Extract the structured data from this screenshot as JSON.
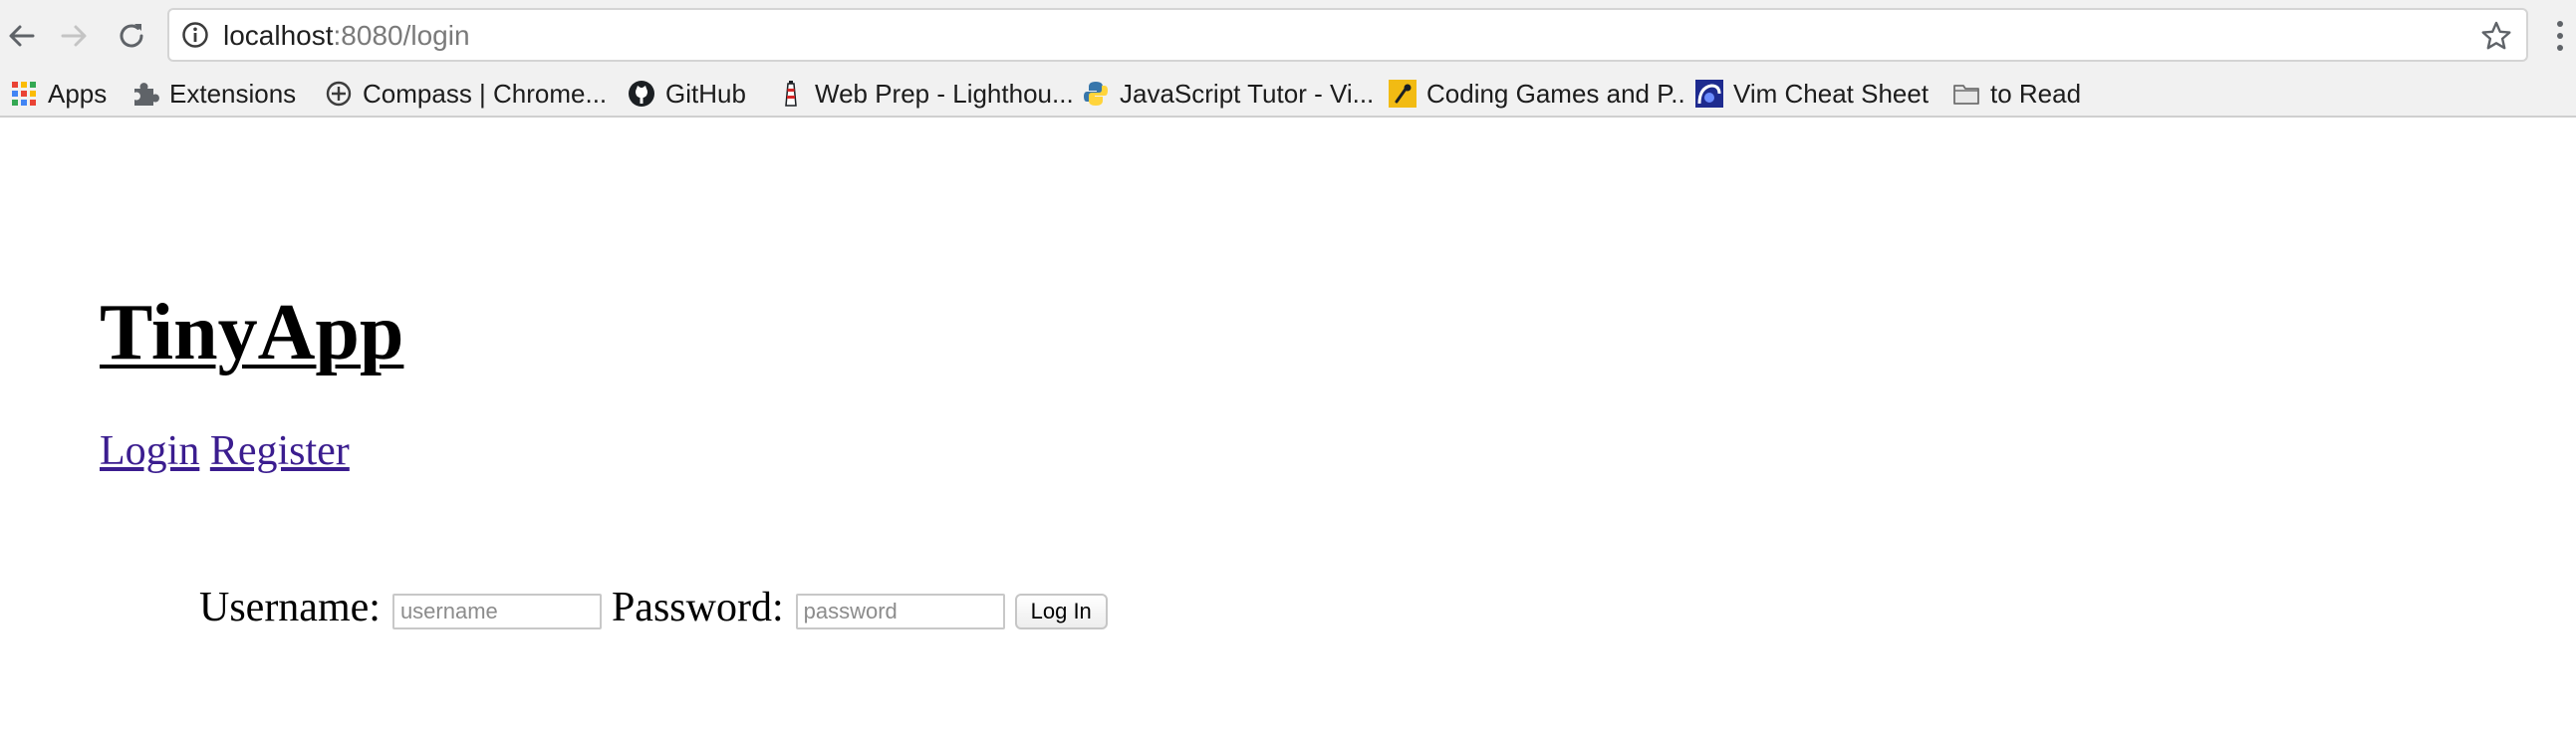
{
  "browser": {
    "url": {
      "host": "localhost",
      "rest": ":8080/login"
    },
    "icons": {
      "back": "arrow-left-icon",
      "forward": "arrow-right-icon",
      "reload": "reload-icon",
      "info": "info-icon",
      "star": "star-icon",
      "menu": "vertical-dots-icon"
    },
    "bookmarks": [
      {
        "label": "Apps",
        "icon": "apps-grid-icon"
      },
      {
        "label": "Extensions",
        "icon": "puzzle-icon"
      },
      {
        "label": "Compass | Chrome...",
        "icon": "compass-icon"
      },
      {
        "label": "GitHub",
        "icon": "github-icon"
      },
      {
        "label": "Web Prep - Lighthou...",
        "icon": "lighthouse-icon"
      },
      {
        "label": "JavaScript Tutor - Vi...",
        "icon": "python-icon"
      },
      {
        "label": "Coding Games and P..",
        "icon": "codingame-icon"
      },
      {
        "label": "Vim Cheat Sheet",
        "icon": "vim-icon"
      },
      {
        "label": "to Read",
        "icon": "folder-icon"
      }
    ]
  },
  "page": {
    "title": "TinyApp",
    "links": {
      "login": "Login",
      "register": "Register"
    },
    "form": {
      "username_label": "Username:",
      "username_placeholder": "username",
      "password_label": "Password:",
      "password_placeholder": "password",
      "submit_label": "Log In"
    }
  },
  "colors": {
    "chrome_bg": "#f1f1f1",
    "link": "#3b1d8f",
    "url_secondary": "#7a7a7a"
  }
}
